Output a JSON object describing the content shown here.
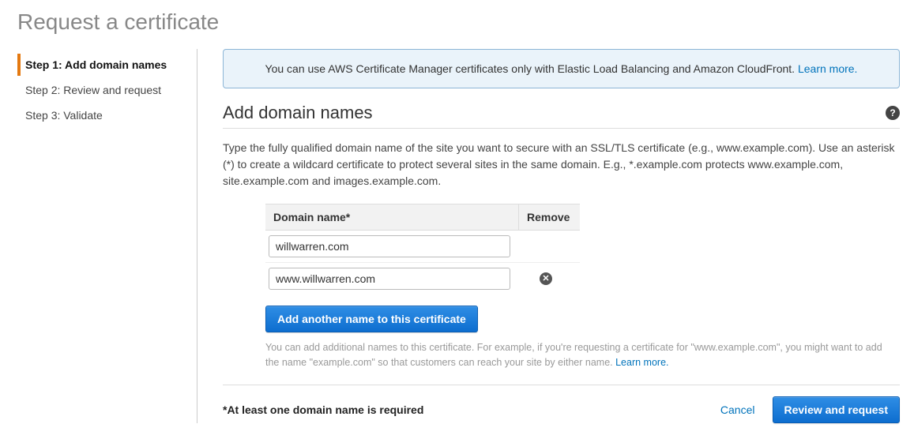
{
  "page": {
    "title": "Request a certificate"
  },
  "sidebar": {
    "steps": [
      {
        "label": "Step 1: Add domain names",
        "active": true
      },
      {
        "label": "Step 2: Review and request",
        "active": false
      },
      {
        "label": "Step 3: Validate",
        "active": false
      }
    ]
  },
  "banner": {
    "text": "You can use AWS Certificate Manager certificates only with Elastic Load Balancing and Amazon CloudFront. ",
    "learn_more": "Learn more."
  },
  "section": {
    "title": "Add domain names",
    "description": "Type the fully qualified domain name of the site you want to secure with an SSL/TLS certificate (e.g., www.example.com). Use an asterisk (*) to create a wildcard certificate to protect several sites in the same domain. E.g., *.example.com protects www.example.com, site.example.com and images.example.com."
  },
  "table": {
    "domain_header": "Domain name*",
    "remove_header": "Remove",
    "rows": [
      {
        "value": "willwarren.com",
        "removable": false
      },
      {
        "value": "www.willwarren.com",
        "removable": true
      }
    ]
  },
  "add_button": "Add another name to this certificate",
  "helper": {
    "text": "You can add additional names to this certificate. For example, if you're requesting a certificate for \"www.example.com\", you might want to add the name \"example.com\" so that customers can reach your site by either name. ",
    "learn_more": "Learn more."
  },
  "footer": {
    "required_msg": "*At least one domain name is required",
    "cancel": "Cancel",
    "review": "Review and request"
  }
}
